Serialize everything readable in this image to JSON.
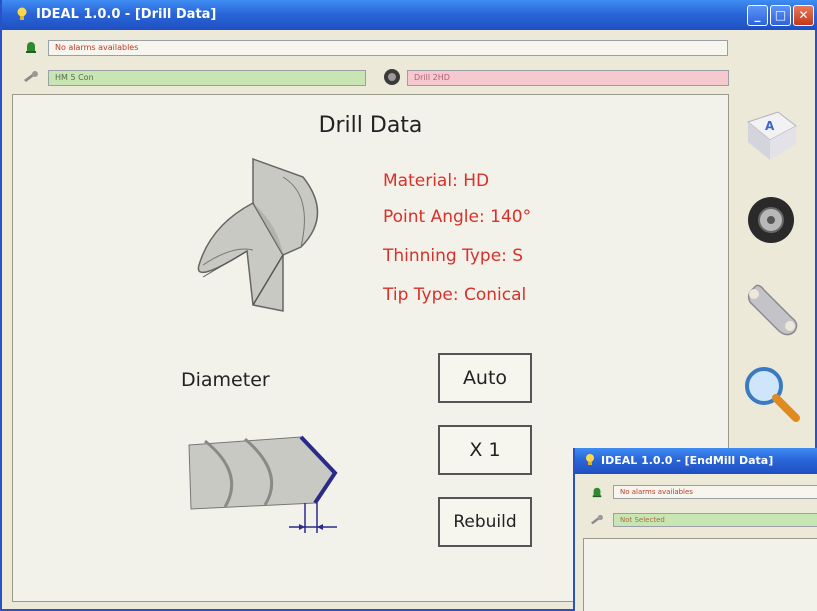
{
  "window": {
    "title": "IDEAL 1.0.0 - [Drill Data]",
    "minimize_label": "_",
    "maximize_label": "□",
    "close_label": "✕"
  },
  "status": {
    "alarm_text": "No alarms availables",
    "tool_text": "HM 5 Con",
    "drill_text": "Drill 2HD"
  },
  "main": {
    "heading": "Drill Data",
    "material": "Material: HD",
    "point_angle": "Point Angle: 140°",
    "thinning_type": "Thinning Type: S",
    "tip_type": "Tip Type: Conical",
    "diameter_label": "Diameter",
    "auto_button": "Auto",
    "x1_button": "X 1",
    "rebuild_button": "Rebuild"
  },
  "sidebar": {
    "icons": [
      "keyboard-key-icon",
      "tire-icon",
      "wrench-icon",
      "magnifier-icon"
    ]
  },
  "window2": {
    "title": "IDEAL 1.0.0 - [EndMill Data]",
    "alarm_text": "No alarms availables",
    "tool_text": "Not Selected"
  },
  "colors": {
    "accent_red": "#d8302a",
    "titlebar_blue": "#2a66d8",
    "green_field": "#c8e6b4",
    "pink_field": "#f6c9cf"
  }
}
